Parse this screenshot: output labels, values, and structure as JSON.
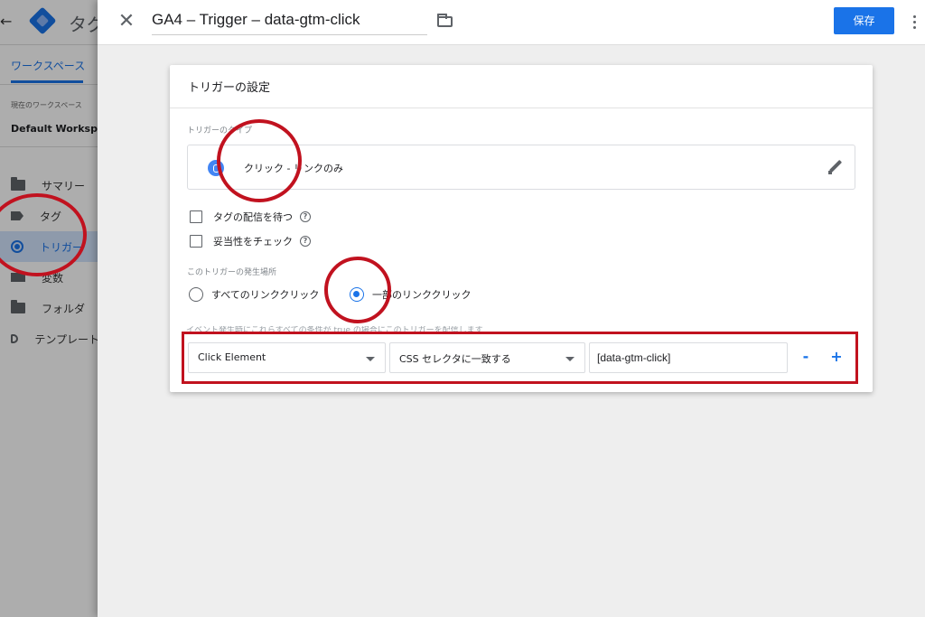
{
  "background": {
    "app_title": "タグ",
    "workspace_tab": "ワークスペース",
    "current_workspace_label": "現在のワークスペース",
    "workspace_name": "Default Workspace",
    "nav": [
      {
        "label": "サマリー",
        "icon": "folder-icon"
      },
      {
        "label": "タグ",
        "icon": "tag-icon"
      },
      {
        "label": "トリガー",
        "icon": "trigger-icon"
      },
      {
        "label": "変数",
        "icon": "variable-icon"
      },
      {
        "label": "フォルダ",
        "icon": "folder-icon"
      },
      {
        "label": "テンプレート",
        "icon": "template-icon"
      }
    ]
  },
  "editor": {
    "trigger_name": "GA4 – Trigger – data-gtm-click",
    "save_label": "保存"
  },
  "card": {
    "title": "トリガーの設定",
    "type_section_label": "トリガーのタイプ",
    "trigger_type": "クリック - リンクのみ",
    "checkboxes": [
      {
        "label": "タグの配信を待つ",
        "checked": false
      },
      {
        "label": "妥当性をチェック",
        "checked": false
      }
    ],
    "fire_on_label": "このトリガーの発生場所",
    "fire_on_options": [
      {
        "label": "すべてのリンククリック",
        "selected": false
      },
      {
        "label": "一部のリンククリック",
        "selected": true
      }
    ],
    "condition_hint": "イベント発生時にこれらすべての条件が true の場合にこのトリガーを配信します",
    "condition": {
      "variable": "Click Element",
      "operator": "CSS セレクタに一致する",
      "value": "[data-gtm-click]",
      "remove_label": "-",
      "add_label": "+"
    }
  },
  "colors": {
    "accent": "#1a73e8",
    "annotation": "#c1121f"
  }
}
